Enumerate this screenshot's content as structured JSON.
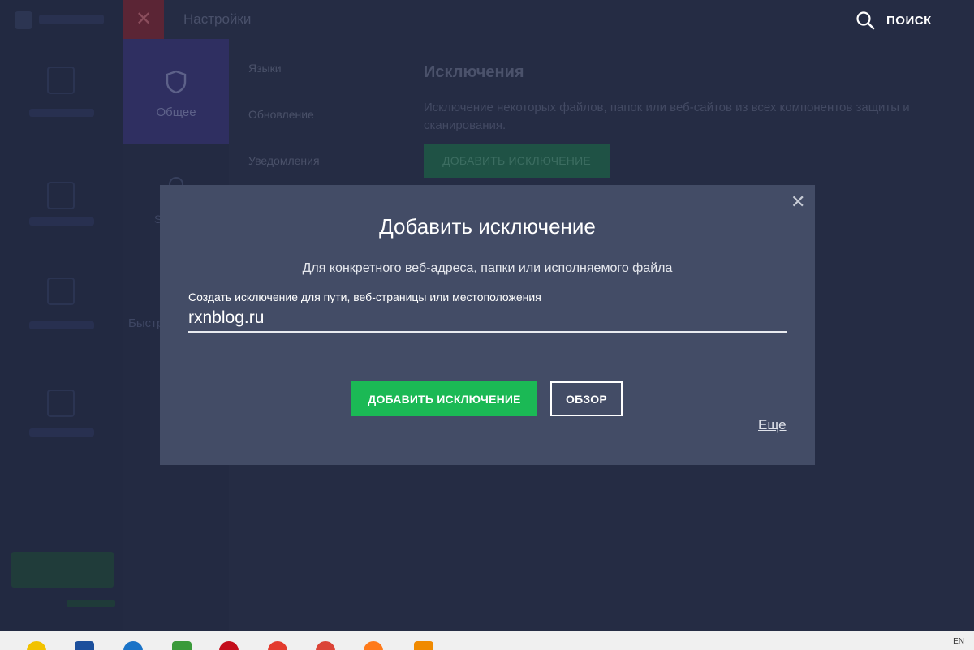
{
  "app": {
    "window_title": "Настройки",
    "search_label": "ПОИСК",
    "categories": {
      "general": "Общее",
      "fast": "Быстр"
    },
    "subnav": [
      "Языки",
      "Обновление",
      "Уведомления"
    ],
    "exclusions": {
      "title": "Исключения",
      "description": "Исключение некоторых файлов, папок или веб-сайтов из всех компонентов защиты и сканирования.",
      "add_button": "ДОБАВИТЬ ИСКЛЮЧЕНИЕ"
    }
  },
  "modal": {
    "title": "Добавить исключение",
    "subtitle": "Для конкретного веб-адреса, папки или исполняемого файла",
    "field_label": "Создать исключение для пути, веб-страницы или местоположения",
    "field_value": "rxnblog.ru",
    "add_button": "ДОБАВИТЬ ИСКЛЮЧЕНИЕ",
    "browse_button": "ОБЗОР",
    "more_link": "Еще",
    "close_icon": "close-icon"
  },
  "colors": {
    "accent_green": "#1bb955",
    "modal_bg": "#434c66",
    "app_bg": "#252c44",
    "close_tab_bg": "#5b2535"
  },
  "taskbar": {
    "icons": [
      "warning-icon",
      "save-icon",
      "ie-icon",
      "app-icon",
      "opera-icon",
      "avira-icon",
      "chrome-icon",
      "firefox-icon",
      "fox-icon"
    ],
    "tray_text": "EN"
  }
}
